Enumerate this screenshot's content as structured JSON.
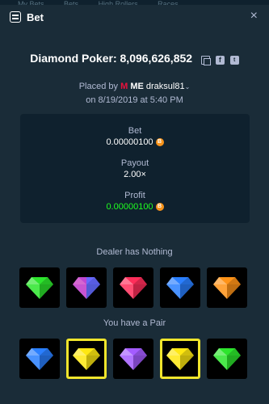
{
  "background_tabs": [
    "My Bets",
    "Bets",
    "High Rollers",
    "Races"
  ],
  "header": {
    "title": "Bet",
    "close_label": "×"
  },
  "game": {
    "name": "Diamond Poker:",
    "bet_id": "8,096,626,852"
  },
  "placed": {
    "prefix": "Placed by",
    "badge": "M",
    "me": "ME",
    "username": "draksul81",
    "date": "on 8/19/2019 at 5:40 PM"
  },
  "stats": {
    "bet_label": "Bet",
    "bet_value": "0.00000100",
    "payout_label": "Payout",
    "payout_value": "2.00×",
    "profit_label": "Profit",
    "profit_value": "0.00000100",
    "coin_symbol": "B"
  },
  "dealer": {
    "label": "Dealer has Nothing",
    "gems": [
      {
        "icon": "green-gem-icon",
        "color": "#2de52d",
        "highlight": false
      },
      {
        "icon": "multicolor-gem-icon",
        "color": "#8a5cff",
        "highlight": false
      },
      {
        "icon": "red-gem-icon",
        "color": "#ff2e5a",
        "highlight": false
      },
      {
        "icon": "blue-gem-icon",
        "color": "#2a7fff",
        "highlight": false
      },
      {
        "icon": "orange-gem-icon",
        "color": "#ff9318",
        "highlight": false
      }
    ]
  },
  "player": {
    "label": "You have a Pair",
    "gems": [
      {
        "icon": "blue-gem-icon",
        "color": "#2a7fff",
        "highlight": false
      },
      {
        "icon": "yellow-gem-icon",
        "color": "#ffe812",
        "highlight": true
      },
      {
        "icon": "purple-gem-icon",
        "color": "#a45cff",
        "highlight": false
      },
      {
        "icon": "yellow-gem-icon",
        "color": "#ffe812",
        "highlight": true
      },
      {
        "icon": "green-gem-icon",
        "color": "#2de52d",
        "highlight": false
      }
    ]
  },
  "colors": {
    "background": "#1a2c38",
    "panel": "#0f212e",
    "profit_green": "#1fff20",
    "highlight_yellow": "#f0e52c",
    "brand_red": "#e9113c"
  }
}
